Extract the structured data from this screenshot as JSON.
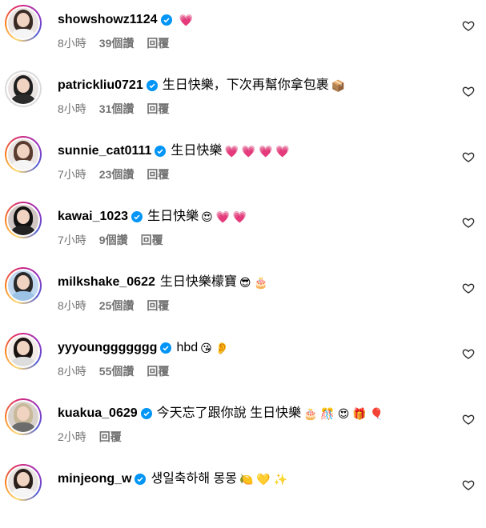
{
  "comments": [
    {
      "username": "showshowz1124",
      "verified": true,
      "text": "",
      "emoji": "💗",
      "time": "8小時",
      "likes": "39個讚",
      "reply": "回覆"
    },
    {
      "username": "patrickliu0721",
      "verified": true,
      "text": "生日快樂，下次再幫你拿包裹",
      "emoji": "📦",
      "time": "8小時",
      "likes": "31個讚",
      "reply": "回覆"
    },
    {
      "username": "sunnie_cat0111",
      "verified": true,
      "text": "生日快樂",
      "emoji": "💗 💗 💗 💗",
      "time": "7小時",
      "likes": "23個讚",
      "reply": "回覆"
    },
    {
      "username": "kawai_1023",
      "verified": true,
      "text": "生日快樂",
      "emoji": "😍 💗 💗",
      "time": "7小時",
      "likes": "9個讚",
      "reply": "回覆"
    },
    {
      "username": "milkshake_0622",
      "verified": false,
      "text": "生日快樂檬寶",
      "emoji": "😎 🎂",
      "time": "8小時",
      "likes": "25個讚",
      "reply": "回覆"
    },
    {
      "username": "yyyounggggggg",
      "verified": true,
      "text": "hbd",
      "emoji": "😘 👂",
      "time": "8小時",
      "likes": "55個讚",
      "reply": "回覆"
    },
    {
      "username": "kuakua_0629",
      "verified": true,
      "text": "今天忘了跟你說 生日快樂",
      "emoji": "🎂 🎊 😍 🎁 🎈",
      "time": "2小時",
      "likes": "",
      "reply": "回覆"
    },
    {
      "username": "minjeong_w",
      "verified": true,
      "text": "생일축하해 몽몽",
      "emoji": "🍋 💛 ✨",
      "time": "",
      "likes": "",
      "reply": ""
    }
  ]
}
